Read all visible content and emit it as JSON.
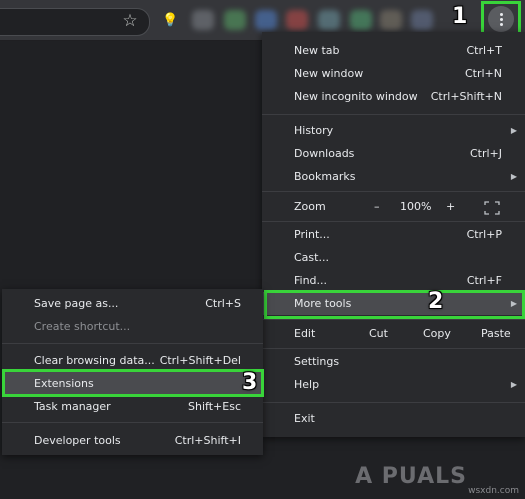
{
  "toolbar": {
    "star_icon": "star-icon",
    "bulb_icon": "lightbulb-icon",
    "menu_icon": "three-dots-icon"
  },
  "main_menu": {
    "new_tab": {
      "label": "New tab",
      "shortcut": "Ctrl+T"
    },
    "new_window": {
      "label": "New window",
      "shortcut": "Ctrl+N"
    },
    "new_incognito": {
      "label": "New incognito window",
      "shortcut": "Ctrl+Shift+N"
    },
    "history": {
      "label": "History"
    },
    "downloads": {
      "label": "Downloads",
      "shortcut": "Ctrl+J"
    },
    "bookmarks": {
      "label": "Bookmarks"
    },
    "zoom": {
      "label": "Zoom",
      "minus": "–",
      "value": "100%",
      "plus": "+",
      "fullscreen_icon": "fullscreen-icon"
    },
    "print": {
      "label": "Print...",
      "shortcut": "Ctrl+P"
    },
    "cast": {
      "label": "Cast..."
    },
    "find": {
      "label": "Find...",
      "shortcut": "Ctrl+F"
    },
    "more_tools": {
      "label": "More tools"
    },
    "edit": {
      "label": "Edit",
      "cut": "Cut",
      "copy": "Copy",
      "paste": "Paste"
    },
    "settings": {
      "label": "Settings"
    },
    "help": {
      "label": "Help"
    },
    "exit": {
      "label": "Exit"
    }
  },
  "sub_menu": {
    "save_page": {
      "label": "Save page as...",
      "shortcut": "Ctrl+S"
    },
    "create_shortcut": {
      "label": "Create shortcut..."
    },
    "clear_browsing": {
      "label": "Clear browsing data...",
      "shortcut": "Ctrl+Shift+Del"
    },
    "extensions": {
      "label": "Extensions"
    },
    "task_manager": {
      "label": "Task manager",
      "shortcut": "Shift+Esc"
    },
    "developer_tools": {
      "label": "Developer tools",
      "shortcut": "Ctrl+Shift+I"
    }
  },
  "annotations": {
    "step1": "1",
    "step2": "2",
    "step3": "3"
  },
  "watermark": {
    "text": "A  PUALS",
    "site": "wsxdn.com"
  },
  "colors": {
    "highlight": "#39d43a",
    "menu_bg": "#292a2d",
    "toolbar_bg": "#35363a"
  }
}
